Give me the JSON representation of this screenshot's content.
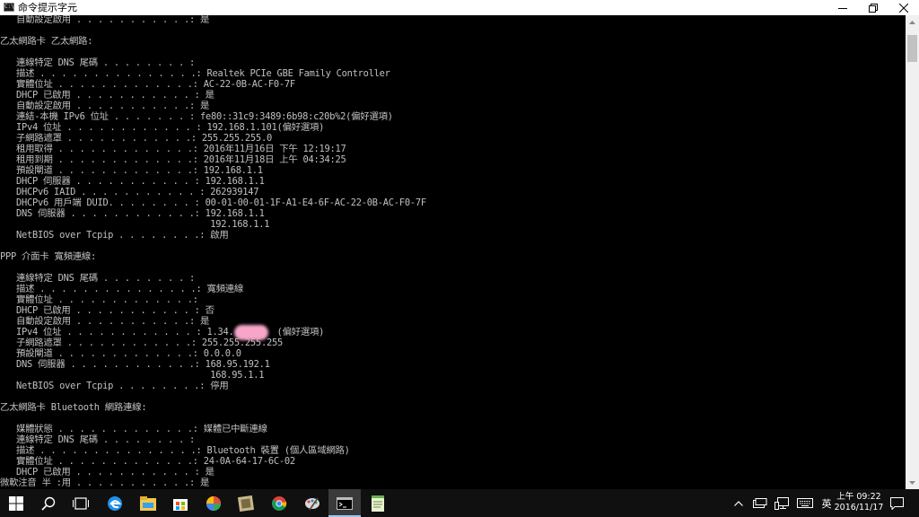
{
  "window": {
    "title": "命令提示字元",
    "icon_text": "C:\\",
    "controls": [
      "minimize-icon",
      "maximize-icon",
      "close-icon"
    ]
  },
  "console": {
    "lines": [
      {
        "label": "   自動設定啟用 . . . . . . . . . . .: ",
        "value": "是"
      },
      {
        "label": "",
        "value": ""
      },
      {
        "label": "乙太網路卡 乙太網路:",
        "value": ""
      },
      {
        "label": "",
        "value": ""
      },
      {
        "label": "   連線特定 DNS 尾碼 . . . . . . . . : ",
        "value": ""
      },
      {
        "label": "   描述 . . . . . . . . . . . . . . .: ",
        "value": "Realtek PCIe GBE Family Controller"
      },
      {
        "label": "   實體位址 . . . . . . . . . . . . .: ",
        "value": "AC-22-0B-AC-F0-7F"
      },
      {
        "label": "   DHCP 已啟用 . . . . . . . . . . . : ",
        "value": "是"
      },
      {
        "label": "   自動設定啟用 . . . . . . . . . . .: ",
        "value": "是"
      },
      {
        "label": "   連結-本機 IPv6 位址 . . . . . . . : ",
        "value": "fe80::31c9:3489:6b98:c20b%2(偏好選項)"
      },
      {
        "label": "   IPv4 位址 . . . . . . . . . . . . : ",
        "value": "192.168.1.101(偏好選項)"
      },
      {
        "label": "   子網路遮罩 . . . . . . . . . . . .: ",
        "value": "255.255.255.0"
      },
      {
        "label": "   租用取得 . . . . . . . . . . . . .: ",
        "value": "2016年11月16日 下午 12:19:17"
      },
      {
        "label": "   租用到期 . . . . . . . . . . . . .: ",
        "value": "2016年11月18日 上午 04:34:25"
      },
      {
        "label": "   預設閘道 . . . . . . . . . . . . .: ",
        "value": "192.168.1.1"
      },
      {
        "label": "   DHCP 伺服器 . . . . . . . . . . . : ",
        "value": "192.168.1.1"
      },
      {
        "label": "   DHCPv6 IAID . . . . . . . . . . . : ",
        "value": "262939147"
      },
      {
        "label": "   DHCPv6 用戶端 DUID. . . . . . . . : ",
        "value": "00-01-00-01-1F-A1-E4-6F-AC-22-0B-AC-F0-7F"
      },
      {
        "label": "   DNS 伺服器 . . . . . . . . . . . .: ",
        "value": "192.168.1.1"
      },
      {
        "label": "                                       ",
        "value": "192.168.1.1"
      },
      {
        "label": "   NetBIOS over Tcpip . . . . . . . .: ",
        "value": "啟用"
      },
      {
        "label": "",
        "value": ""
      },
      {
        "label": "PPP 介面卡 寬頻連線:",
        "value": ""
      },
      {
        "label": "",
        "value": ""
      },
      {
        "label": "   連線特定 DNS 尾碼 . . . . . . . . : ",
        "value": ""
      },
      {
        "label": "   描述 . . . . . . . . . . . . . . .: ",
        "value": "寬頻連線"
      },
      {
        "label": "   實體位址 . . . . . . . . . . . . .: ",
        "value": ""
      },
      {
        "label": "   DHCP 已啟用 . . . . . . . . . . . : ",
        "value": "否"
      },
      {
        "label": "   自動設定啟用 . . . . . . . . . . .: ",
        "value": "是"
      },
      {
        "label": "   IPv4 位址 . . . . . . . . . . . . : ",
        "value": "1.34.        (偏好選項)"
      },
      {
        "label": "   子網路遮罩 . . . . . . . . . . . .: ",
        "value": "255.255.255.255"
      },
      {
        "label": "   預設閘道 . . . . . . . . . . . . .: ",
        "value": "0.0.0.0"
      },
      {
        "label": "   DNS 伺服器 . . . . . . . . . . . .: ",
        "value": "168.95.192.1"
      },
      {
        "label": "                                       ",
        "value": "168.95.1.1"
      },
      {
        "label": "   NetBIOS over Tcpip . . . . . . . .: ",
        "value": "停用"
      },
      {
        "label": "",
        "value": ""
      },
      {
        "label": "乙太網路卡 Bluetooth 網路連線:",
        "value": ""
      },
      {
        "label": "",
        "value": ""
      },
      {
        "label": "   媒體狀態 . . . . . . . . . . . . .: ",
        "value": "媒體已中斷連線"
      },
      {
        "label": "   連線特定 DNS 尾碼 . . . . . . . . : ",
        "value": ""
      },
      {
        "label": "   描述 . . . . . . . . . . . . . . .: ",
        "value": "Bluetooth 裝置 (個人區域網路)"
      },
      {
        "label": "   實體位址 . . . . . . . . . . . . .: ",
        "value": "24-0A-64-17-6C-02"
      },
      {
        "label": "   DHCP 已啟用 . . . . . . . . . . . : ",
        "value": "是"
      },
      {
        "label": "微軟注音 半 :用 . . . . . . . . . . .: ",
        "value": "是"
      }
    ]
  },
  "taskbar": {
    "apps": [
      "windows-start-icon",
      "search-icon",
      "task-view-icon",
      "edge-icon",
      "file-explorer-icon",
      "store-icon",
      "photos-icon",
      "app-icon",
      "chrome-icon",
      "paint-icon",
      "command-prompt-icon",
      "notepad-icon"
    ],
    "tray_language": "英",
    "clock_time": "上午 09:22",
    "clock_date": "2016/11/17"
  }
}
